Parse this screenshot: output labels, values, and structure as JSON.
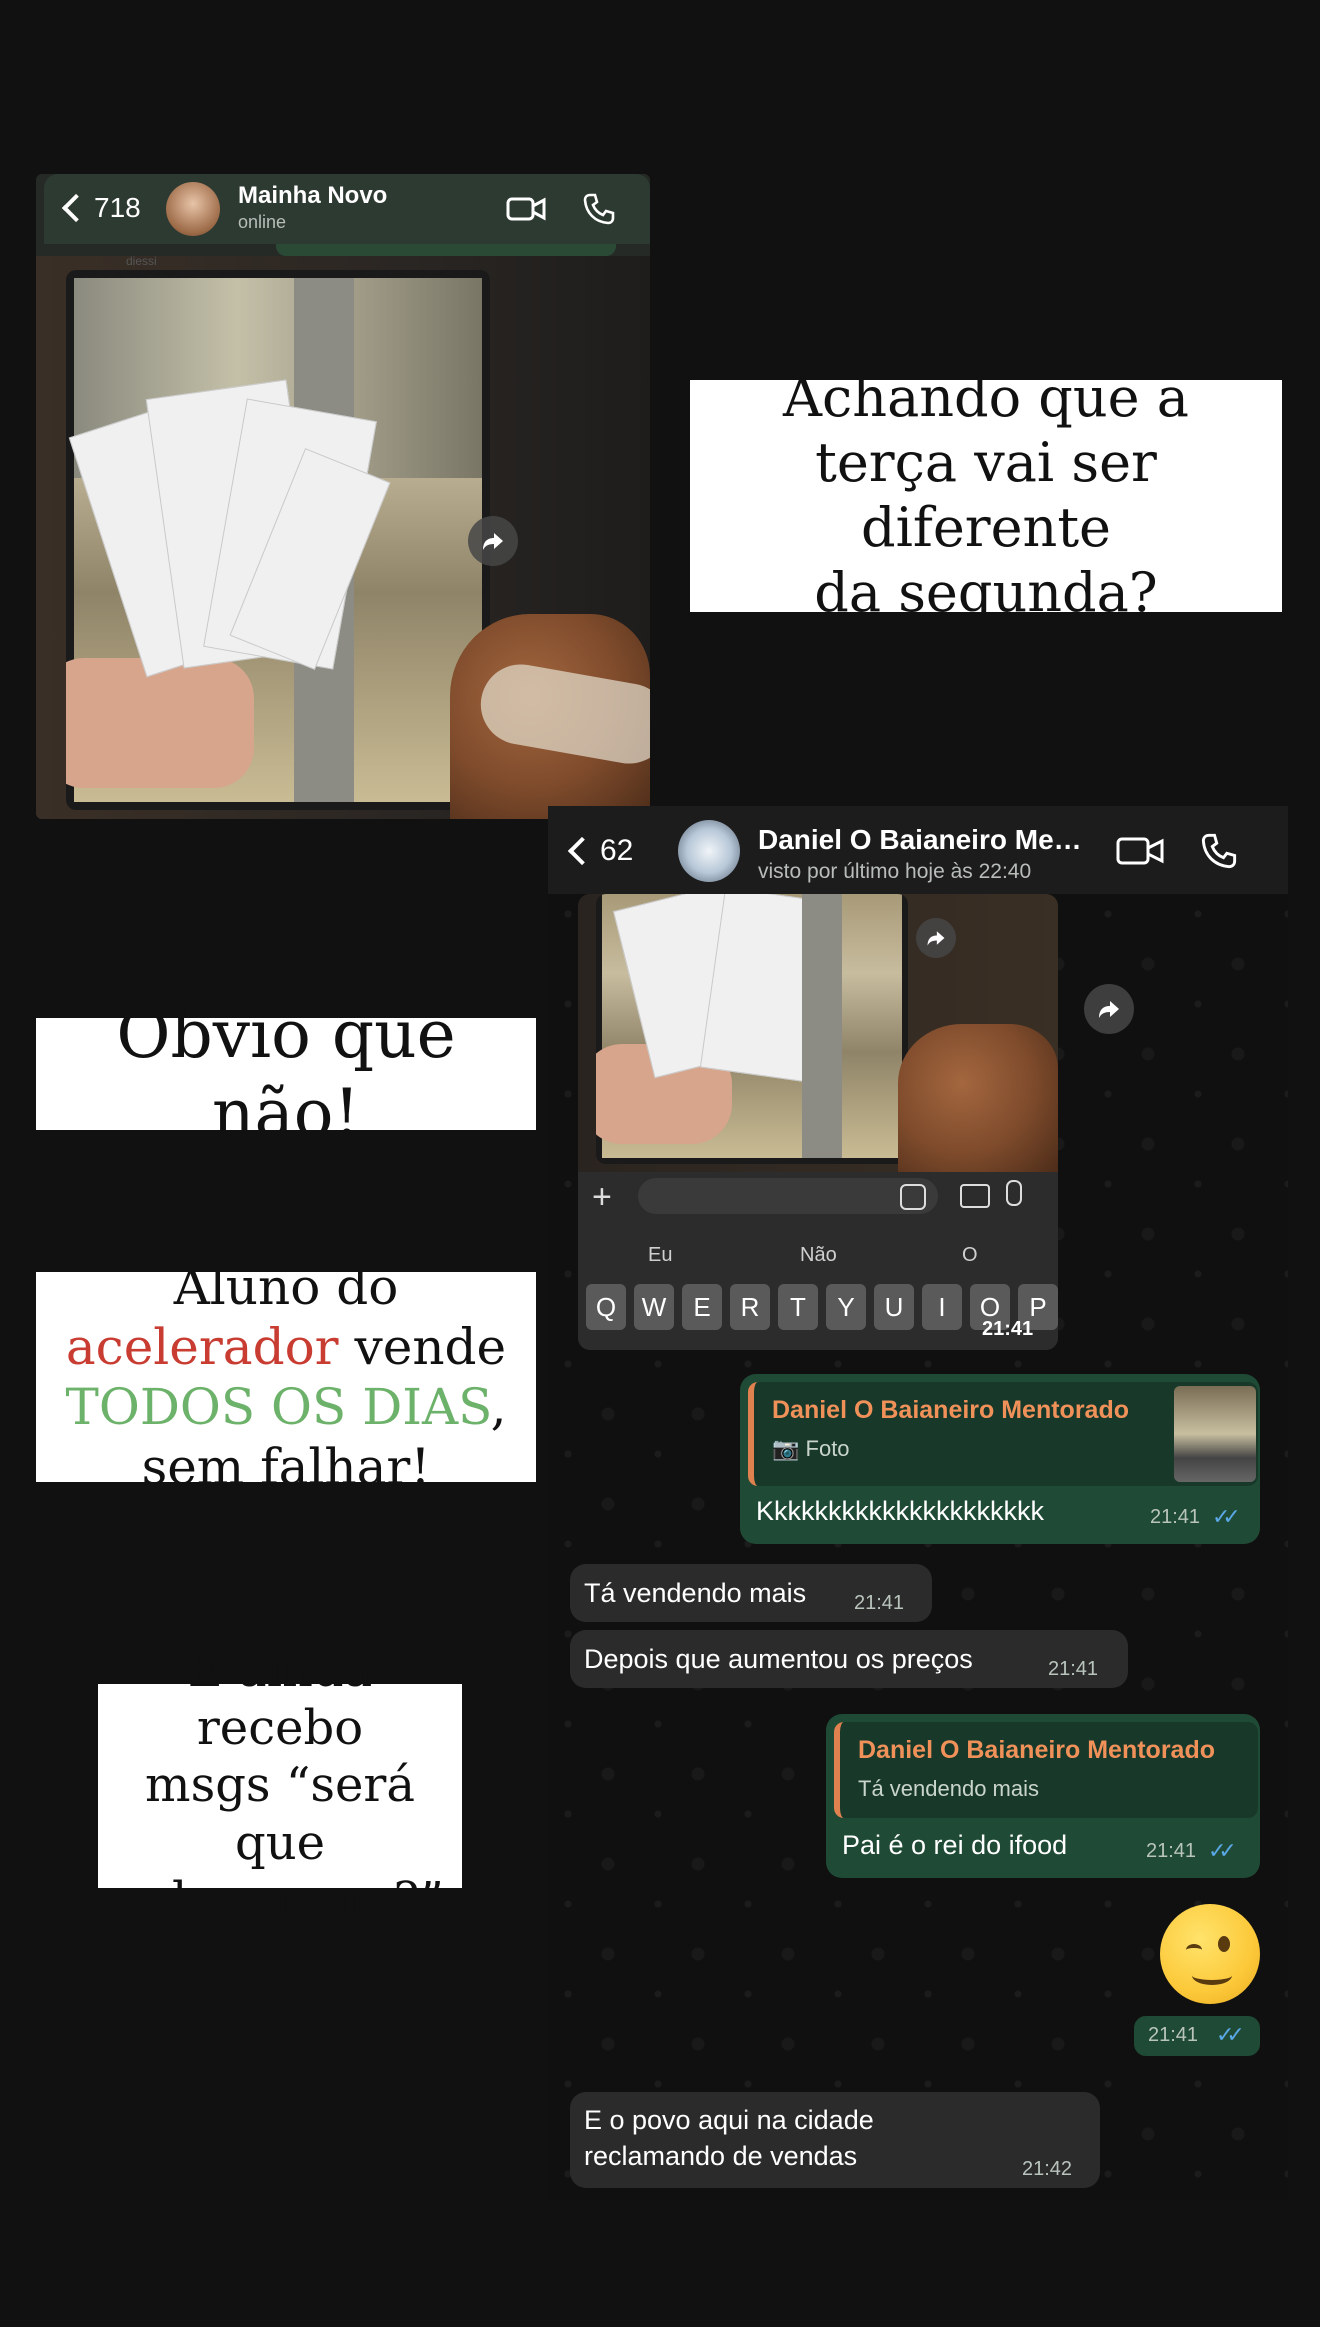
{
  "caption1": {
    "line1": "Achando que a",
    "line2": "terça vai ser diferente",
    "line3": "da segunda?"
  },
  "caption2": {
    "text": "Óbvio que não!"
  },
  "caption3": {
    "p1": "Aluno do ",
    "p2": "acelerador",
    "p3": " vende ",
    "p4": "TODOS OS DIAS",
    "p5": ", sem falhar!"
  },
  "caption4": {
    "line1": "E ainda recebo",
    "line2": "msgs “será que",
    "line3": "vale a pena?”"
  },
  "chat1": {
    "back_count": "718",
    "contact_name": "Mainha Novo",
    "status": "online",
    "icons": [
      "video-icon",
      "phone-icon",
      "forward-icon"
    ],
    "stamp": "diessi"
  },
  "chat2": {
    "back_count": "62",
    "contact_name": "Daniel O Baianeiro Me…",
    "status": "visto por último hoje às 22:40",
    "inner": {
      "suggestions": [
        "Eu",
        "Não",
        "O"
      ],
      "keys": [
        "Q",
        "W",
        "E",
        "R",
        "T",
        "Y",
        "U",
        "I",
        "O",
        "P"
      ],
      "time": "21:41"
    },
    "messages": [
      {
        "dir": "out",
        "quote_name": "Daniel O Baianeiro Mentorado",
        "quote_text": "Foto",
        "text": "Kkkkkkkkkkkkkkkkkkkkk",
        "time": "21:41"
      },
      {
        "dir": "in",
        "text": "Tá vendendo mais",
        "time": "21:41"
      },
      {
        "dir": "in",
        "text": "Depois que aumentou os preços",
        "time": "21:41"
      },
      {
        "dir": "out",
        "quote_name": "Daniel O Baianeiro Mentorado",
        "quote_text": "Tá vendendo mais",
        "text": "Pai é o rei do ifood",
        "time": "21:41"
      },
      {
        "dir": "out",
        "emoji": "winking-face",
        "time": "21:41"
      },
      {
        "dir": "in",
        "text": "E o povo aqui na cidade reclamando de vendas",
        "time": "21:42"
      }
    ]
  },
  "colors": {
    "accent_red": "#c83c32",
    "accent_green": "#6db26a",
    "out_bubble": "#1f4a35",
    "in_bubble": "#2b2b2b",
    "quote_name": "#f0915a",
    "read_ticks": "#5aa7e6"
  }
}
